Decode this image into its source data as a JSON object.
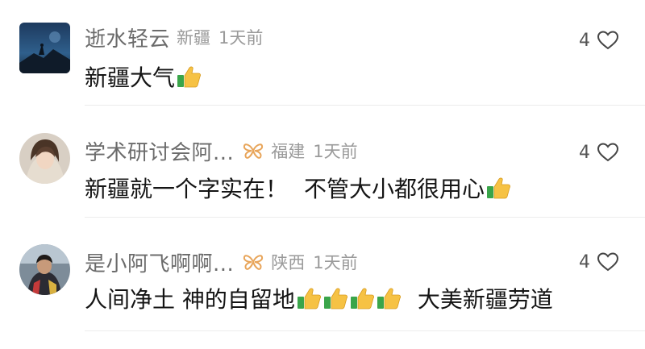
{
  "comments": [
    {
      "username": "逝水轻云",
      "location": "新疆",
      "time": "1天前",
      "text": "新疆大气",
      "likes": "4",
      "has_badge": false,
      "avatar": "landscape-avatar"
    },
    {
      "username": "学术研讨会阿...",
      "location": "福建",
      "time": "1天前",
      "text_part1": "新疆就一个字实在！",
      "text_part2": "不管大小都很用心",
      "likes": "4",
      "has_badge": true,
      "avatar": "portrait-avatar"
    },
    {
      "username": "是小阿飞啊啊...",
      "location": "陕西",
      "time": "1天前",
      "text_part1": "人间净土 神的自留地",
      "text_part2": "大美新疆劳道",
      "likes": "4",
      "has_badge": true,
      "avatar": "person-avatar"
    }
  ],
  "icons": {
    "like": "heart-outline-icon",
    "emoji": "thumbs-up-emoji",
    "badge": "butterfly-badge-icon"
  },
  "colors": {
    "username": "#6b6b6b",
    "meta": "#9a9a9a",
    "text": "#141414",
    "badge": "#e8a55a"
  }
}
